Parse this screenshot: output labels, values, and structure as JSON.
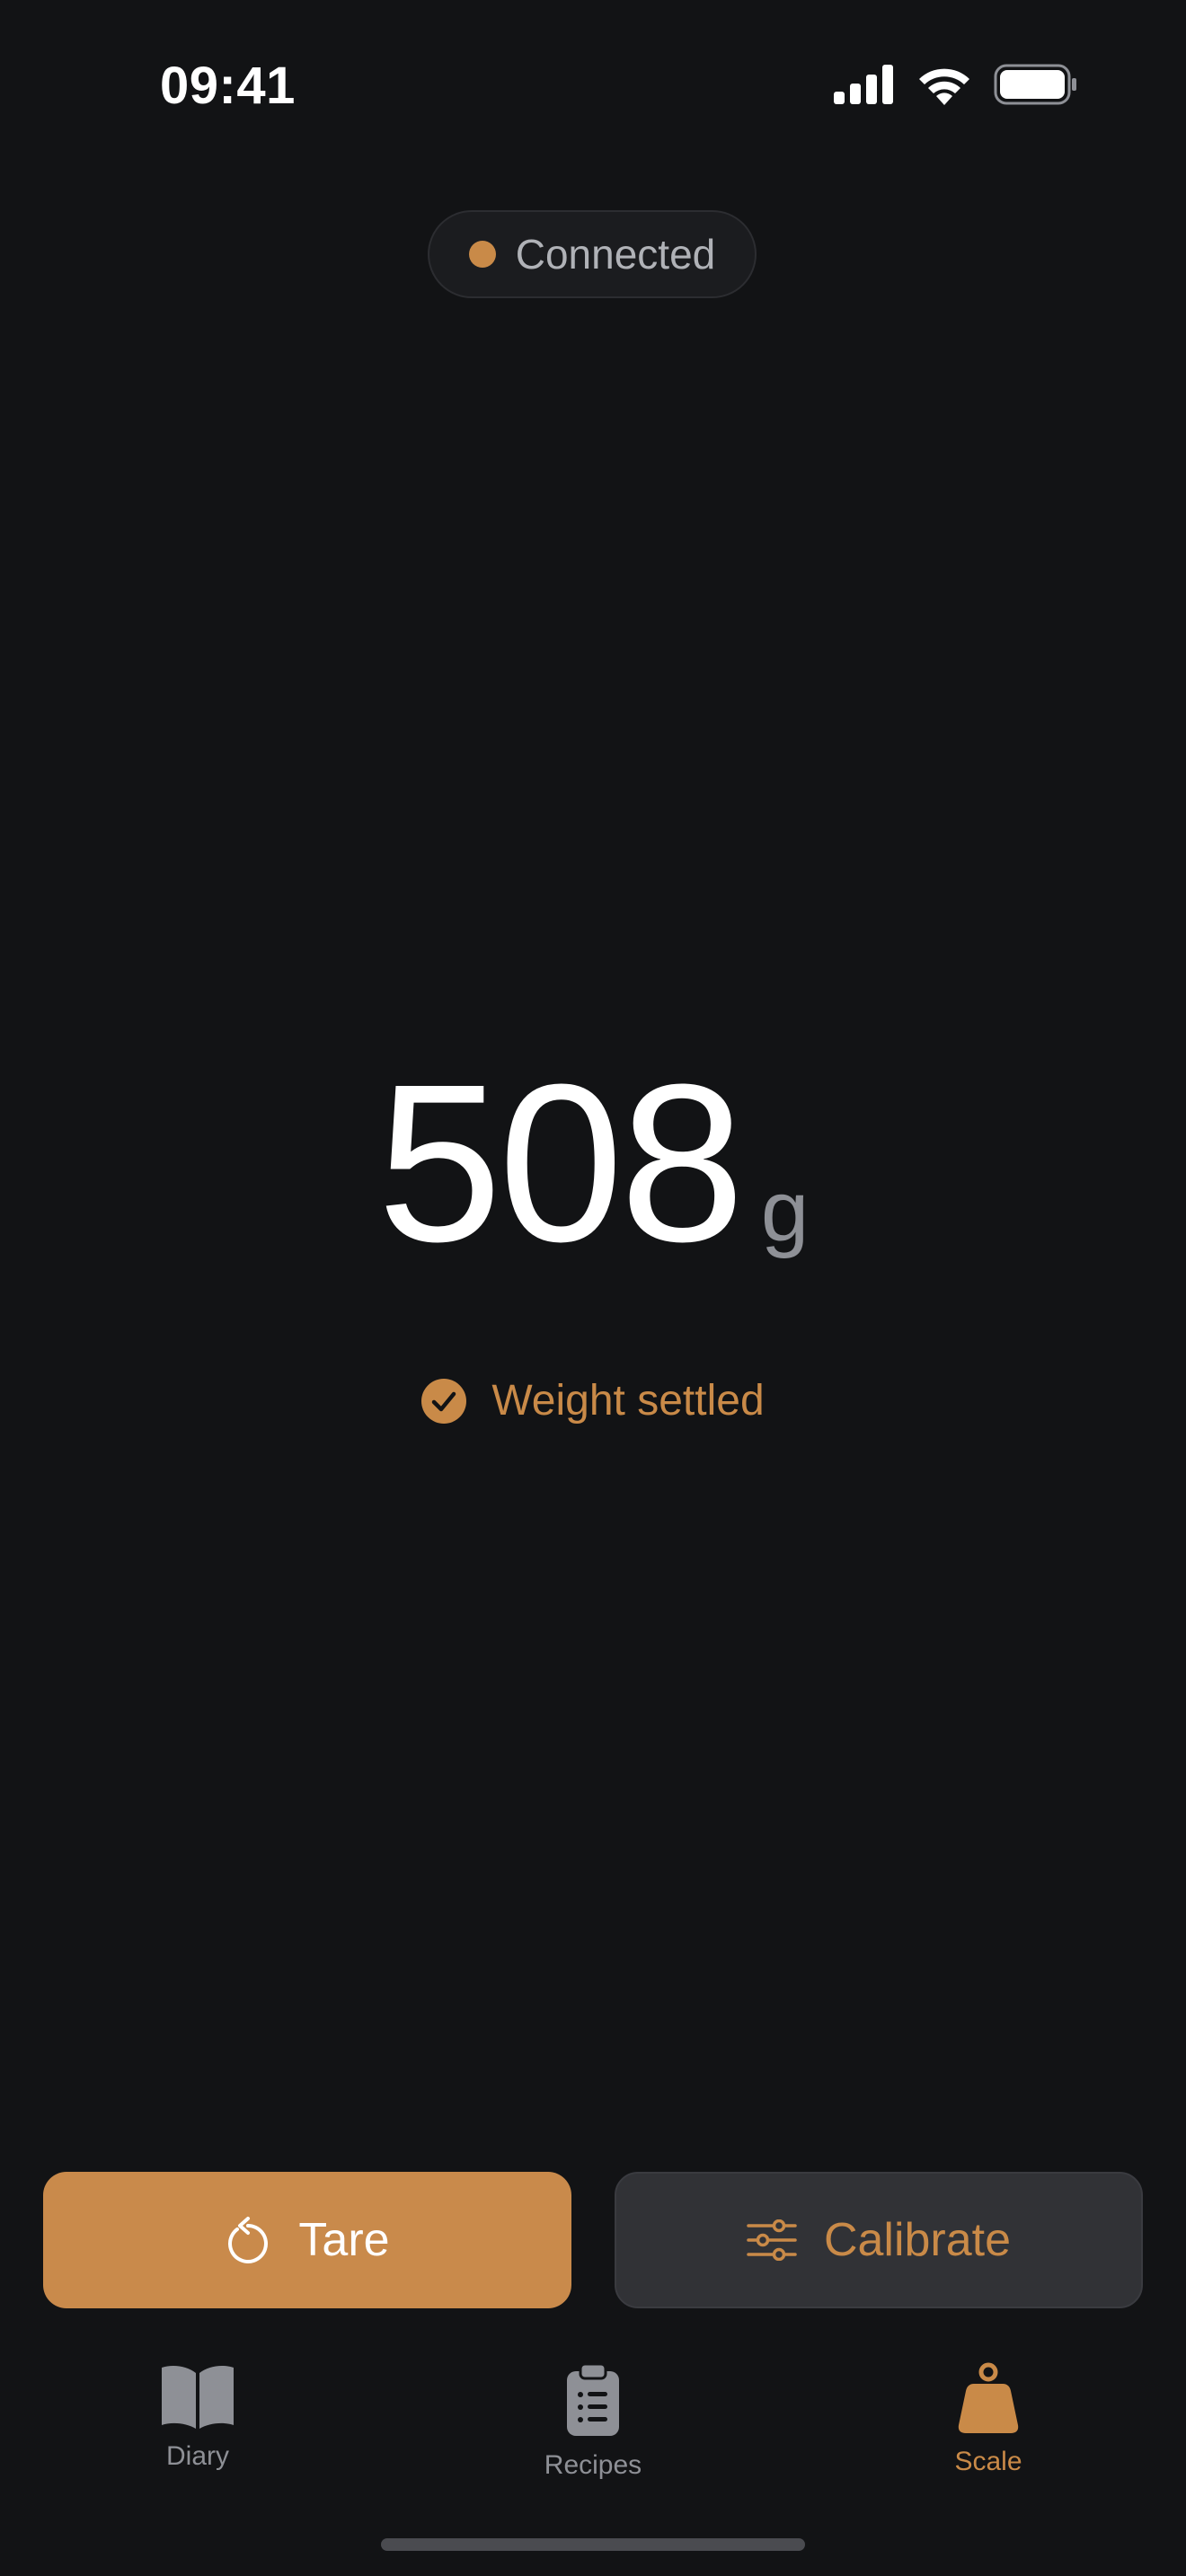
{
  "status_bar": {
    "time": "09:41",
    "icons": [
      "cellular-signal-icon",
      "wifi-icon",
      "battery-icon"
    ]
  },
  "connection": {
    "label": "Connected",
    "dot_color": "#c98a48"
  },
  "scale": {
    "weight": "508",
    "unit": "g",
    "status_label": "Weight settled",
    "status_icon": "checkmark-circle-icon"
  },
  "actions": {
    "tare_label": "Tare",
    "tare_icon": "rotate-ccw-icon",
    "calibrate_label": "Calibrate",
    "calibrate_icon": "sliders-icon"
  },
  "tab_bar": {
    "items": [
      {
        "label": "Diary",
        "icon": "book-icon",
        "active": false
      },
      {
        "label": "Recipes",
        "icon": "clipboard-list-icon",
        "active": false
      },
      {
        "label": "Scale",
        "icon": "weight-icon",
        "active": true
      }
    ]
  },
  "colors": {
    "background": "#121315",
    "accent": "#c98a48",
    "text_primary": "#ffffff",
    "text_secondary": "#8e9096"
  }
}
